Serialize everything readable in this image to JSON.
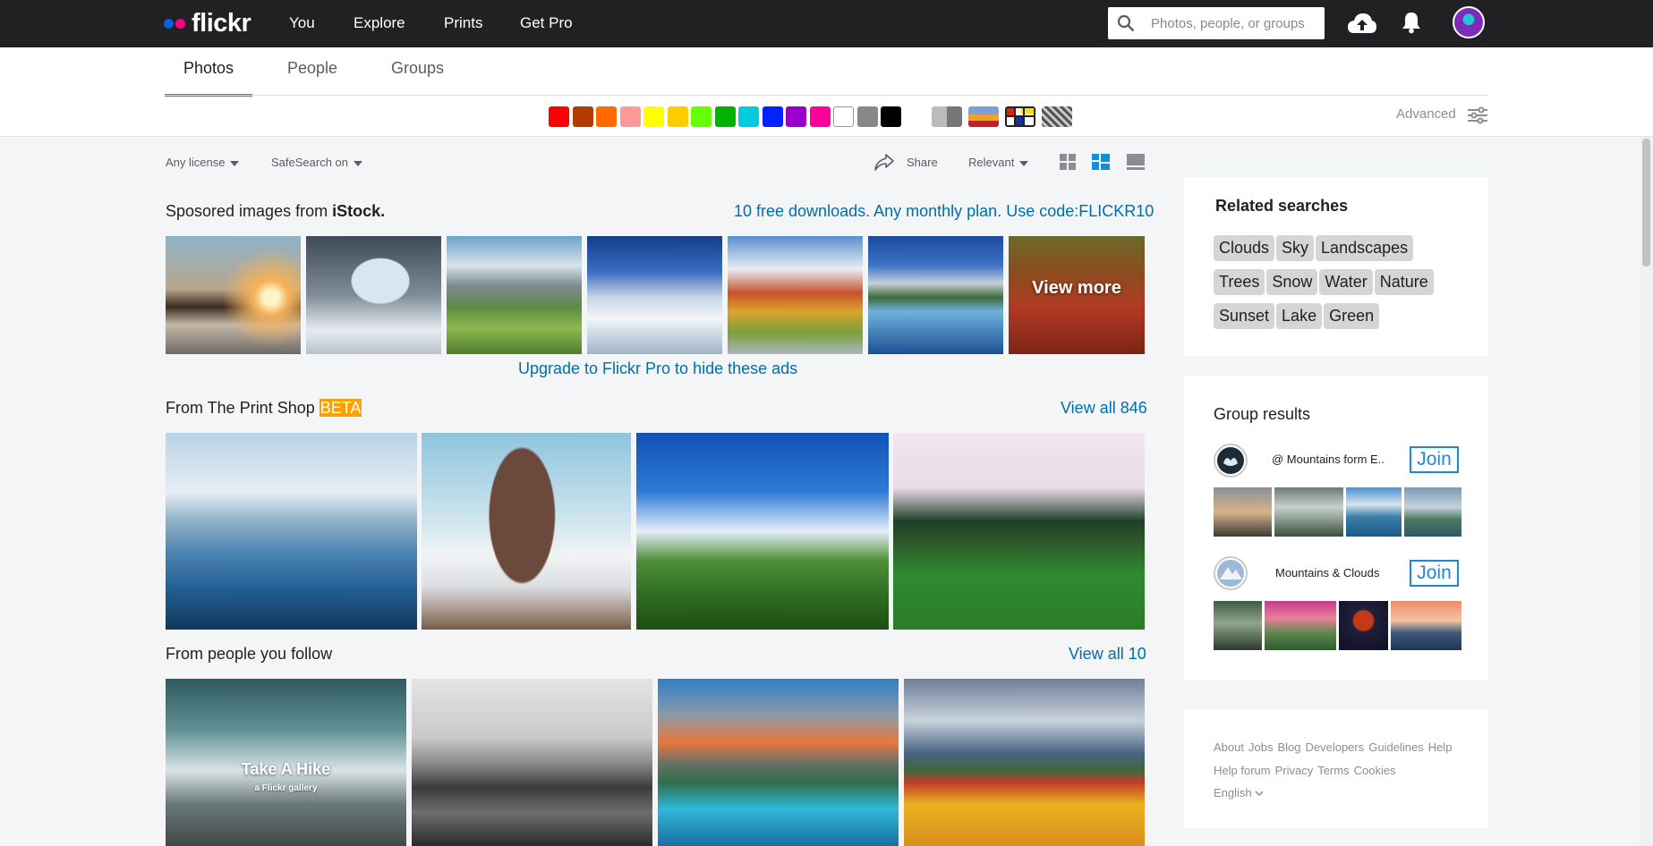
{
  "nav": {
    "logo": "flickr",
    "links": [
      "You",
      "Explore",
      "Prints",
      "Get Pro"
    ],
    "search_placeholder": "Photos, people, or groups"
  },
  "tabs": [
    "Photos",
    "People",
    "Groups"
  ],
  "color_filters": [
    "#ff0000",
    "#b23b00",
    "#ff6a00",
    "#ff9999",
    "#ffff00",
    "#ffcc00",
    "#66ff00",
    "#00b300",
    "#00ccdd",
    "#0022ff",
    "#9900cc",
    "#ff0099",
    "#ffffff",
    "#888888",
    "#000000"
  ],
  "advanced_label": "Advanced",
  "toolbar": {
    "license": "Any license",
    "safesearch": "SafeSearch on",
    "share": "Share",
    "sort": "Relevant"
  },
  "sponsored": {
    "title_prefix": "Sposored images from",
    "title_brand": "iStock.",
    "promo": "10 free downloads. Any monthly plan. Use code:FLICKR10",
    "view_more": "View more",
    "upgrade": "Upgrade to Flickr Pro to hide these ads"
  },
  "print_shop": {
    "title": "From The Print Shop",
    "badge": "BETA",
    "view_all": "View all 846"
  },
  "following": {
    "title": "From people you follow",
    "view_all": "View all 10",
    "gallery_title": "Take A Hike",
    "gallery_sub": "a Flickr gallery"
  },
  "related": {
    "title": "Related searches",
    "chips": [
      [
        "Clouds",
        "Sky",
        "Landscapes"
      ],
      [
        "Trees",
        "Snow",
        "Water",
        "Nature"
      ],
      [
        "Sunset",
        "Lake",
        "Green"
      ]
    ]
  },
  "groups": {
    "title": "Group results",
    "items": [
      {
        "name": "@ Mountains form E..",
        "join": "Join"
      },
      {
        "name": "Mountains & Clouds",
        "join": "Join"
      }
    ]
  },
  "footer": {
    "row1": [
      "About",
      "Jobs",
      "Blog",
      "Developers",
      "Guidelines",
      "Help"
    ],
    "row2": [
      "Help forum",
      "Privacy",
      "Terms",
      "Cookies"
    ],
    "language": "English"
  }
}
